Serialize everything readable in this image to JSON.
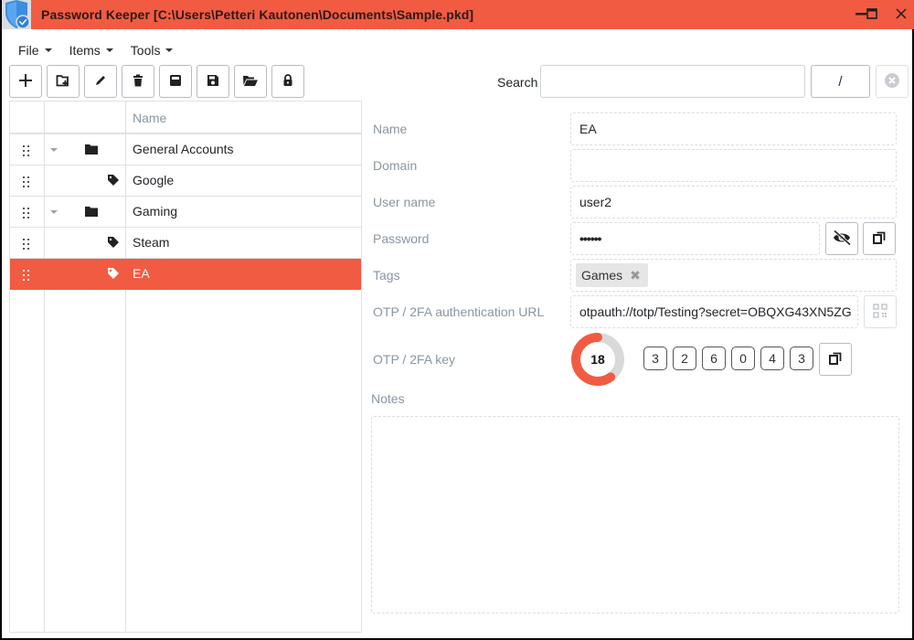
{
  "window": {
    "title": "Password Keeper [C:\\Users\\Petteri Kautonen\\Documents\\Sample.pkd]",
    "accent_color": "#f15b42",
    "app_icon": "shield-check-icon",
    "controls": [
      "minimize-icon",
      "maximize-icon",
      "close-icon"
    ]
  },
  "menubar": {
    "items": [
      {
        "label": "File"
      },
      {
        "label": "Items"
      },
      {
        "label": "Tools"
      }
    ]
  },
  "toolbar": {
    "buttons": [
      {
        "name": "add-item",
        "icon": "plus-icon"
      },
      {
        "name": "add-folder",
        "icon": "folder-plus-icon"
      },
      {
        "name": "edit",
        "icon": "pencil-icon"
      },
      {
        "name": "delete",
        "icon": "trash-icon"
      },
      {
        "name": "save",
        "icon": "save-icon"
      },
      {
        "name": "save-as",
        "icon": "floppy-icon"
      },
      {
        "name": "open",
        "icon": "folder-open-icon"
      },
      {
        "name": "lock",
        "icon": "lock-icon"
      }
    ]
  },
  "search": {
    "label": "Search",
    "value": "",
    "placeholder": "",
    "slash_label": "/",
    "clear_icon": "circle-x-icon"
  },
  "tree": {
    "header": {
      "name": "Name"
    },
    "rows": [
      {
        "label": "General Accounts",
        "type": "folder",
        "expanded": true,
        "level": 0,
        "selected": false
      },
      {
        "label": "Google",
        "type": "item",
        "level": 1,
        "selected": false
      },
      {
        "label": "Gaming",
        "type": "folder",
        "expanded": true,
        "level": 0,
        "selected": false
      },
      {
        "label": "Steam",
        "type": "item",
        "level": 1,
        "selected": false
      },
      {
        "label": "EA",
        "type": "item",
        "level": 1,
        "selected": true
      }
    ]
  },
  "details": {
    "name": {
      "label": "Name",
      "value": "EA"
    },
    "domain": {
      "label": "Domain",
      "value": ""
    },
    "username": {
      "label": "User name",
      "value": "user2"
    },
    "password": {
      "label": "Password",
      "value": "••••••",
      "toggle_icon": "eye-slash-icon",
      "copy_icon": "copy-icon"
    },
    "tags": {
      "label": "Tags",
      "values": [
        "Games"
      ]
    },
    "otp_url": {
      "label": "OTP / 2FA authentication URL",
      "value": "otpauth://totp/Testing?secret=OBQXG43XN5ZG",
      "qr_icon": "qr-code-icon"
    },
    "otp_key": {
      "label": "OTP / 2FA key",
      "seconds_remaining": 18,
      "period_seconds": 30,
      "timer_color": "#f15b42",
      "digits": [
        "3",
        "2",
        "6",
        "0",
        "4",
        "3"
      ],
      "copy_icon": "copy-icon"
    },
    "notes": {
      "label": "Notes",
      "value": ""
    }
  }
}
